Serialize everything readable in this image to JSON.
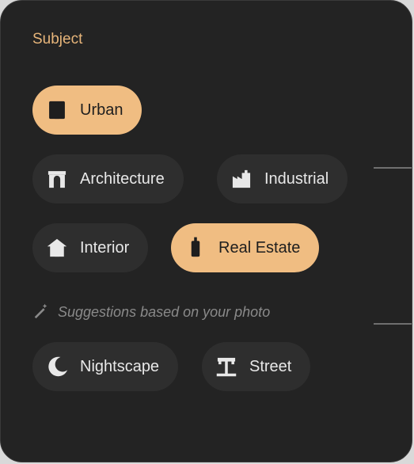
{
  "panel": {
    "title": "Subject",
    "chips": [
      {
        "label": "Urban",
        "icon": "building-icon",
        "selected": true
      },
      {
        "label": "Architecture",
        "icon": "archway-icon",
        "selected": false
      },
      {
        "label": "Industrial",
        "icon": "factory-icon",
        "selected": false
      },
      {
        "label": "Interior",
        "icon": "house-icon",
        "selected": false
      },
      {
        "label": "Real Estate",
        "icon": "tower-icon",
        "selected": true
      }
    ],
    "suggestion_hint": "Suggestions based on your photo",
    "suggestions": [
      {
        "label": "Nightscape",
        "icon": "moon-icon"
      },
      {
        "label": "Street",
        "icon": "street-icon"
      }
    ]
  },
  "colors": {
    "panel_bg": "#232323",
    "chip_bg": "#2e2e2e",
    "accent": "#f0bd82",
    "title": "#e7b57a"
  }
}
